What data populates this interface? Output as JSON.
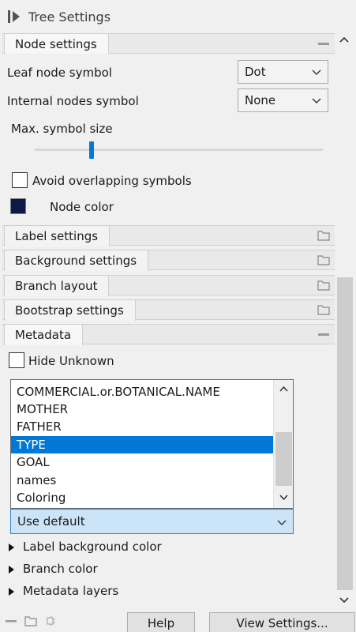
{
  "window": {
    "title": "Tree Settings"
  },
  "sections": {
    "node_settings": "Node settings",
    "label_settings": "Label settings",
    "background_settings": "Background settings",
    "branch_layout": "Branch layout",
    "bootstrap_settings": "Bootstrap settings",
    "metadata": "Metadata"
  },
  "node_settings": {
    "leaf_label": "Leaf node symbol",
    "leaf_value": "Dot",
    "internal_label": "Internal nodes symbol",
    "internal_value": "None",
    "max_size_label": "Max. symbol size",
    "max_size_level": 0.2,
    "avoid_overlap_label": "Avoid overlapping symbols",
    "avoid_overlap_checked": false,
    "node_color_label": "Node color",
    "node_color": "#0d1a46"
  },
  "metadata": {
    "hide_unknown_label": "Hide Unknown",
    "hide_unknown_checked": false,
    "list_items": [
      "COMMERCIAL.or.BOTANICAL.NAME",
      "MOTHER",
      "FATHER",
      "TYPE",
      "GOAL",
      "names",
      "Coloring"
    ],
    "selected_item": "TYPE",
    "default_combo": "Use default",
    "tree_items": [
      "Label background color",
      "Branch color",
      "Metadata layers"
    ]
  },
  "footer": {
    "help": "Help",
    "view_settings": "View Settings..."
  },
  "colors": {
    "accent": "#0078d7",
    "selected_combo": "#cce4f7"
  }
}
